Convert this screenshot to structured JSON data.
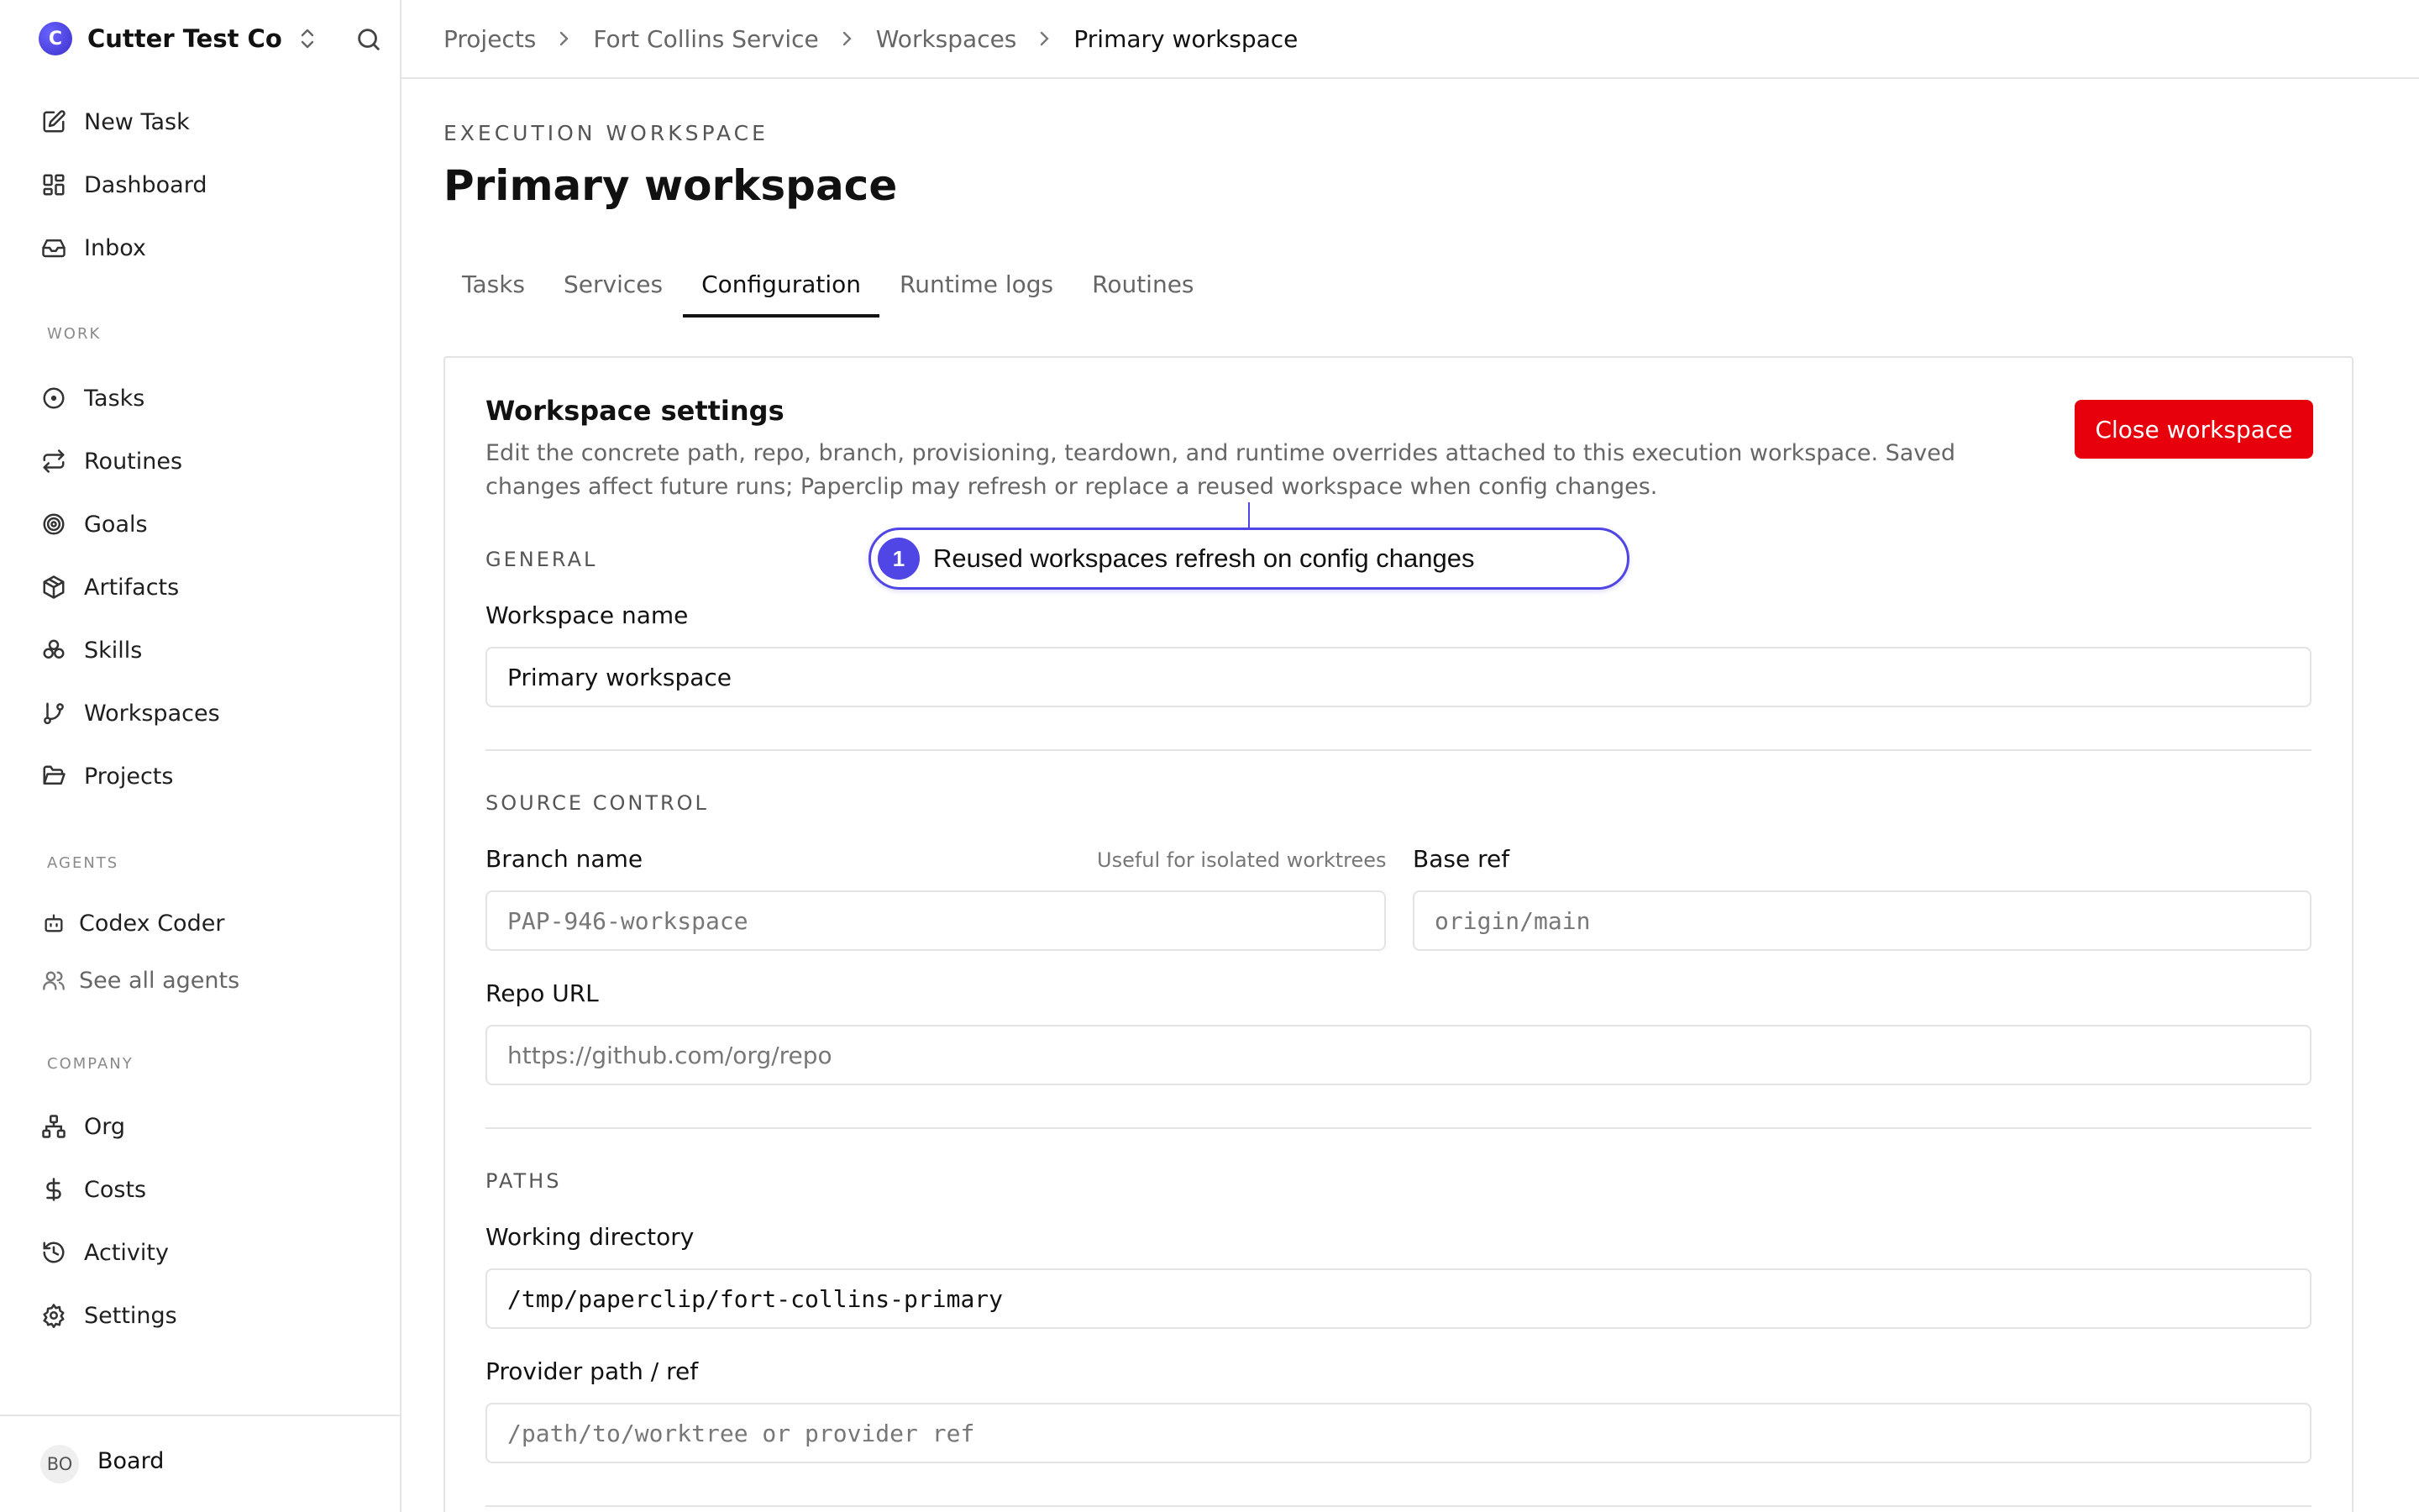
{
  "company": {
    "name": "Cutter Test Co",
    "logo_letter": "C"
  },
  "sidebar": {
    "top_items": [
      {
        "label": "New Task",
        "icon": "edit-icon"
      },
      {
        "label": "Dashboard",
        "icon": "dashboard-icon"
      },
      {
        "label": "Inbox",
        "icon": "inbox-icon"
      }
    ],
    "work_label": "WORK",
    "work_items": [
      {
        "label": "Tasks",
        "icon": "circle-dot-icon"
      },
      {
        "label": "Routines",
        "icon": "repeat-icon"
      },
      {
        "label": "Goals",
        "icon": "target-icon"
      },
      {
        "label": "Artifacts",
        "icon": "package-icon"
      },
      {
        "label": "Skills",
        "icon": "boxes-icon"
      },
      {
        "label": "Workspaces",
        "icon": "git-branch-icon"
      },
      {
        "label": "Projects",
        "icon": "folder-open-icon"
      }
    ],
    "agents_label": "AGENTS",
    "agent_items": [
      {
        "label": "Codex Coder",
        "icon": "bot-icon"
      },
      {
        "label": "See all agents",
        "icon": "users-icon"
      }
    ],
    "company_label": "COMPANY",
    "company_items": [
      {
        "label": "Org",
        "icon": "network-icon"
      },
      {
        "label": "Costs",
        "icon": "dollar-icon"
      },
      {
        "label": "Activity",
        "icon": "history-icon"
      },
      {
        "label": "Settings",
        "icon": "gear-icon"
      }
    ],
    "footer": {
      "avatar": "BO",
      "label": "Board"
    }
  },
  "breadcrumb": [
    "Projects",
    "Fort Collins Service",
    "Workspaces",
    "Primary workspace"
  ],
  "page": {
    "eyebrow": "EXECUTION WORKSPACE",
    "title": "Primary workspace",
    "tabs": [
      "Tasks",
      "Services",
      "Configuration",
      "Runtime logs",
      "Routines"
    ],
    "active_tab": "Configuration"
  },
  "settings": {
    "title": "Workspace settings",
    "description": "Edit the concrete path, repo, branch, provisioning, teardown, and runtime overrides attached to this execution workspace. Saved changes affect future runs; Paperclip may refresh or replace a reused workspace when config changes.",
    "close_label": "Close workspace",
    "general": {
      "label": "GENERAL",
      "name_label": "Workspace name",
      "name_value": "Primary workspace"
    },
    "source": {
      "label": "SOURCE CONTROL",
      "branch_label": "Branch name",
      "branch_hint": "Useful for isolated worktrees",
      "branch_placeholder": "PAP-946-workspace",
      "base_label": "Base ref",
      "base_placeholder": "origin/main",
      "repo_label": "Repo URL",
      "repo_placeholder": "https://github.com/org/repo"
    },
    "paths": {
      "label": "PATHS",
      "workdir_label": "Working directory",
      "workdir_value": "/tmp/paperclip/fort-collins-primary",
      "provider_label": "Provider path / ref",
      "provider_placeholder": "/path/to/worktree or provider ref"
    }
  },
  "annotation": {
    "number": "1",
    "text": "Reused workspaces refresh on config changes",
    "color": "#4f46e5"
  },
  "colors": {
    "danger": "#e7000b",
    "accent": "#4f46e5"
  }
}
